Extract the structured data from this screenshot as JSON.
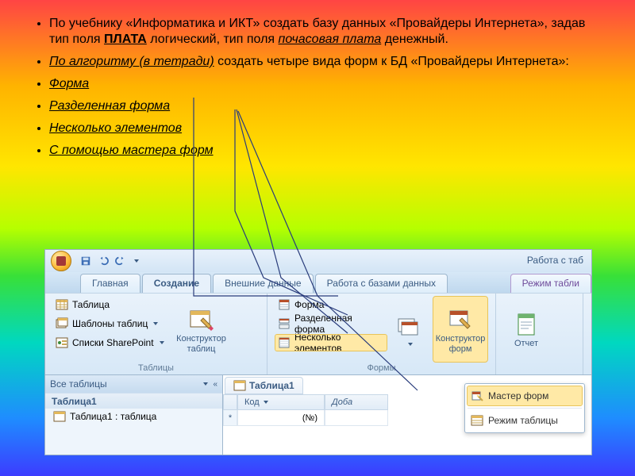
{
  "bullets": {
    "b1_pre": "По учебнику «Информатика и ИКТ» создать базу данных «Провайдеры Интернета», задав тип поля ",
    "b1_strong": "ПЛАТА",
    "b1_mid": " логический, тип поля ",
    "b1_em": "почасовая плата",
    "b1_post": " денежный.",
    "b2_u": "По алгоритму (в тетради)",
    "b2_rest": " создать четыре вида форм к БД «Провайдеры Интернета»:",
    "b3": "Форма",
    "b4": "Разделенная форма",
    "b5": "Несколько элементов",
    "b6": "С помощью мастера форм"
  },
  "access": {
    "tool_title": "Работа с таб",
    "tabs": {
      "home": "Главная",
      "create": "Создание",
      "external": "Внешние данные",
      "dbtools": "Работа с базами данных",
      "ctx": "Режим табли"
    },
    "groups": {
      "tables": {
        "label": "Таблицы",
        "items": {
          "table": "Таблица",
          "templates": "Шаблоны таблиц",
          "sharepoint": "Списки SharePoint"
        },
        "big": "Конструктор таблиц"
      },
      "forms": {
        "label": "Формы",
        "items": {
          "form": "Форма",
          "split": "Разделенная форма",
          "multi": "Несколько элементов"
        },
        "big": "Конструктор форм"
      },
      "reports": {
        "big": "Отчет"
      }
    },
    "nav": {
      "header": "Все таблицы",
      "shutter": "«",
      "cat": "Таблица1",
      "cat_dd": "☆",
      "item": "Таблица1 : таблица"
    },
    "sheet": {
      "tab": "Таблица1",
      "col_id": "Код",
      "col_add": "Доба",
      "newrow": "(№)",
      "star": "*"
    },
    "menu": {
      "wizard": "Мастер форм",
      "tableview": "Режим таблицы"
    }
  }
}
